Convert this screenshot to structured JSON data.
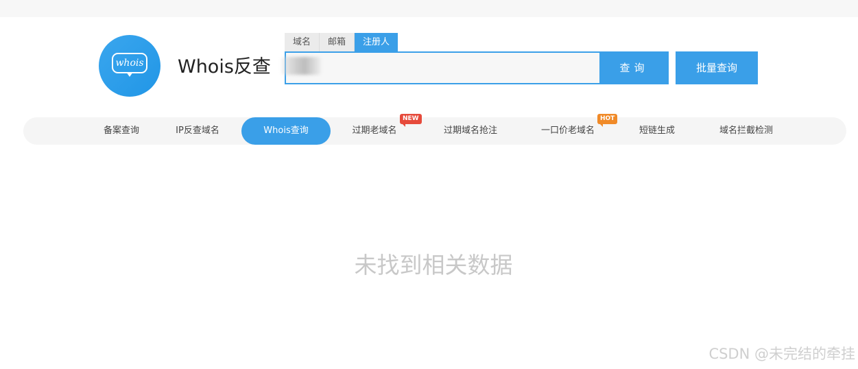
{
  "header": {
    "logo_text": "whois",
    "site_title": "Whois反查"
  },
  "search": {
    "tabs": [
      {
        "label": "域名",
        "active": false
      },
      {
        "label": "邮箱",
        "active": false
      },
      {
        "label": "注册人",
        "active": true
      }
    ],
    "input_value": "",
    "query_label": "查询",
    "batch_label": "批量查询"
  },
  "nav": {
    "items": [
      {
        "label": "备案查询",
        "active": false,
        "badge": ""
      },
      {
        "label": "IP反查域名",
        "active": false,
        "badge": ""
      },
      {
        "label": "Whois查询",
        "active": true,
        "badge": ""
      },
      {
        "label": "过期老域名",
        "active": false,
        "badge": "NEW"
      },
      {
        "label": "过期域名抢注",
        "active": false,
        "badge": ""
      },
      {
        "label": "一口价老域名",
        "active": false,
        "badge": "HOT"
      },
      {
        "label": "短链生成",
        "active": false,
        "badge": ""
      },
      {
        "label": "域名拦截检测",
        "active": false,
        "badge": ""
      }
    ]
  },
  "results": {
    "empty_message": "未找到相关数据"
  },
  "watermark": "CSDN @未完结的牵挂",
  "colors": {
    "accent": "#3a9fe8",
    "badge_new": "#e64a3b",
    "badge_hot": "#f08a28",
    "empty_text": "#c8c8c8"
  }
}
